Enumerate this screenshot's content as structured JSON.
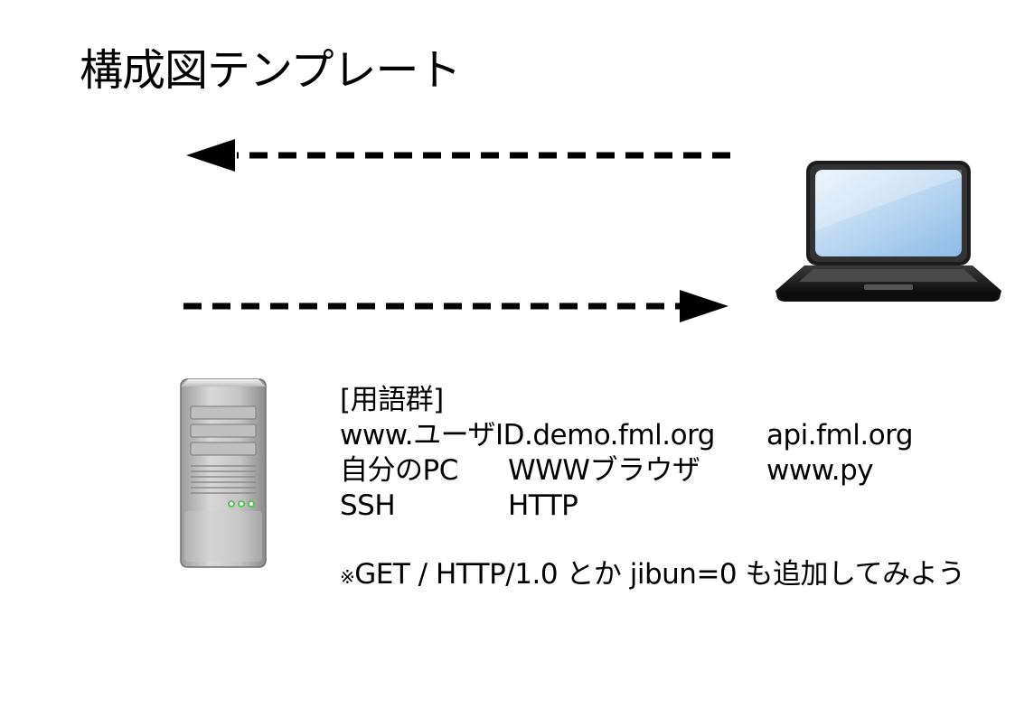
{
  "title": "構成図テンプレート",
  "terms": {
    "heading": "[用語群]",
    "row1": {
      "col1": "www.ユーザID.demo.fml.org",
      "col2": "api.fml.org"
    },
    "row2": {
      "col1": "自分のPC",
      "col2": "WWWブラウザ",
      "col3": "www.py"
    },
    "row3": {
      "col1": "SSH",
      "col2": "HTTP"
    }
  },
  "note": {
    "mark": "※",
    "text": "GET / HTTP/1.0 とか jibun=0 も追加してみよう"
  },
  "icons": {
    "laptop": "laptop-icon",
    "server": "server-tower-icon",
    "arrow_top": "dashed-arrow-left",
    "arrow_bottom": "dashed-arrow-right"
  },
  "colors": {
    "text": "#000000",
    "laptop_screen": "#a9cdee",
    "server_led": "#4ec24e"
  }
}
